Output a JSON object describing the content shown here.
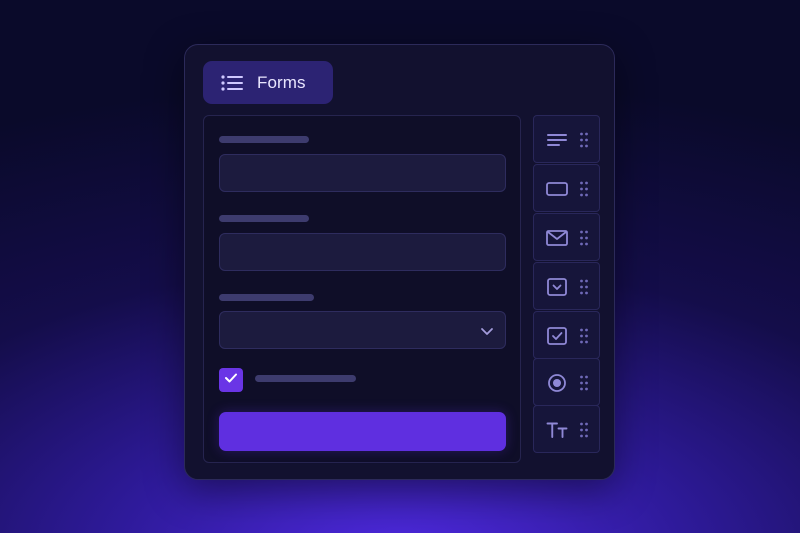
{
  "window": {
    "title": "Forms",
    "title_icon": "list-icon"
  },
  "form": {
    "fields": [
      {
        "kind": "text-input",
        "label": "",
        "value": "",
        "placeholder": ""
      },
      {
        "kind": "text-input",
        "label": "",
        "value": "",
        "placeholder": ""
      },
      {
        "kind": "select",
        "label": "",
        "selected": "",
        "icon": "chevron-down-icon"
      }
    ],
    "checkbox": {
      "checked": true,
      "label": "",
      "icon": "check-icon"
    },
    "submit_label": ""
  },
  "palette": {
    "items": [
      {
        "name": "paragraph",
        "icon": "paragraph-icon"
      },
      {
        "name": "input",
        "icon": "input-box-icon"
      },
      {
        "name": "email",
        "icon": "mail-icon"
      },
      {
        "name": "dropdown",
        "icon": "dropdown-icon"
      },
      {
        "name": "checkbox",
        "icon": "checkbox-icon"
      },
      {
        "name": "radio",
        "icon": "radio-icon"
      },
      {
        "name": "text",
        "icon": "text-style-icon"
      }
    ],
    "handle_icon": "drag-handle-icon"
  },
  "colors": {
    "accent": "#5f2fe0",
    "icon": "#8f88d6",
    "panel": "#12112f",
    "title_pill": "#2c2373"
  }
}
